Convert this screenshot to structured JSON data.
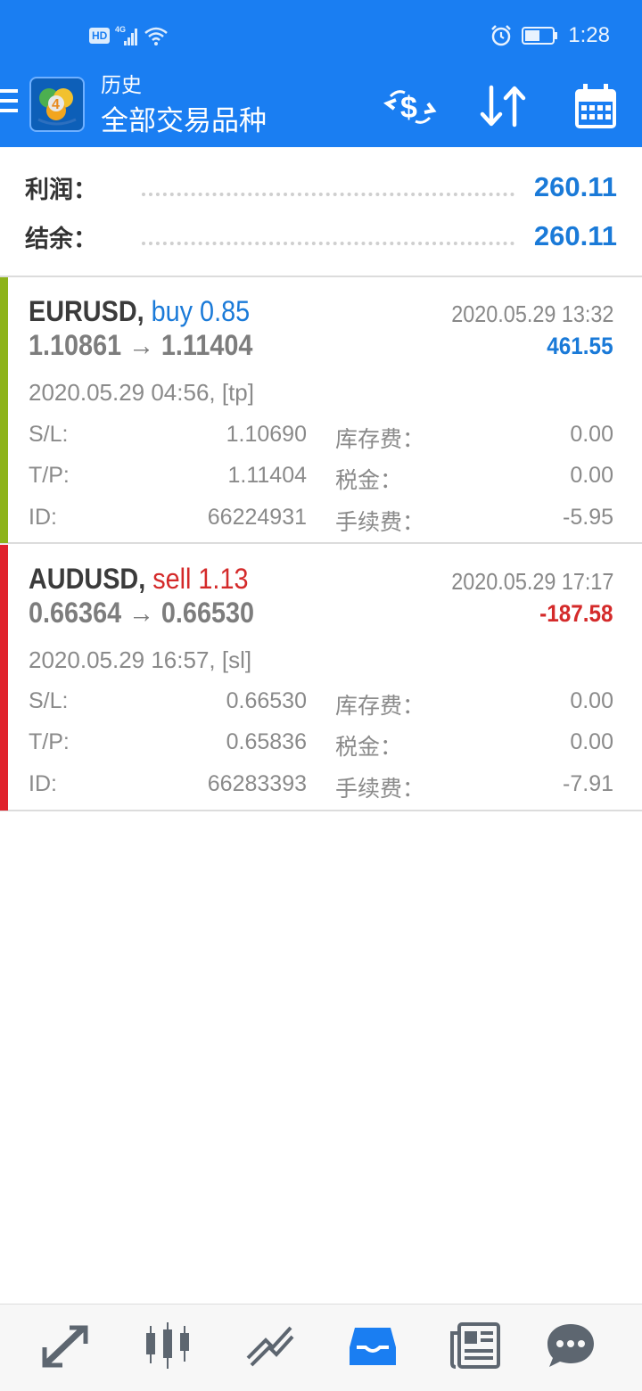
{
  "status_bar": {
    "network_badge": "HD",
    "signal_label": "4G",
    "time": "1:28",
    "icons": [
      "hd-icon",
      "signal-icon",
      "wifi-icon",
      "alarm-icon",
      "battery-icon"
    ]
  },
  "app_bar": {
    "title": "历史",
    "subtitle": "全部交易品种",
    "actions": [
      "currency-exchange-icon",
      "sort-icon",
      "calendar-icon"
    ],
    "colors": {
      "background": "#1a7ef2"
    }
  },
  "summary": {
    "profit_label": "利润：",
    "profit_value": "260.11",
    "balance_label": "结余：",
    "balance_value": "260.11",
    "value_color": "#1a7ad8"
  },
  "trades": [
    {
      "symbol": "EURUSD",
      "separator": ",",
      "side": "buy 0.85",
      "side_color": "#1a7ad8",
      "bar_color": "#8db31a",
      "close_time": "2020.05.29 13:32",
      "open_price": "1.10861",
      "arrow": "→",
      "close_price": "1.11404",
      "profit": "461.55",
      "profit_color": "#1a7ad8",
      "open_time": "2020.05.29 04:56, [tp]",
      "sl_label": "S/L:",
      "sl_value": "1.10690",
      "tp_label": "T/P:",
      "tp_value": "1.11404",
      "id_label": "ID:",
      "id_value": "66224931",
      "swap_label": "库存费：",
      "swap_value": "0.00",
      "tax_label": "税金：",
      "tax_value": "0.00",
      "commission_label": "手续费：",
      "commission_value": "-5.95"
    },
    {
      "symbol": "AUDUSD",
      "separator": ",",
      "side": "sell 1.13",
      "side_color": "#d42a2a",
      "bar_color": "#e0222b",
      "close_time": "2020.05.29 17:17",
      "open_price": "0.66364",
      "arrow": "→",
      "close_price": "0.66530",
      "profit": "-187.58",
      "profit_color": "#d42a2a",
      "open_time": "2020.05.29 16:57, [sl]",
      "sl_label": "S/L:",
      "sl_value": "0.66530",
      "tp_label": "T/P:",
      "tp_value": "0.65836",
      "id_label": "ID:",
      "id_value": "66283393",
      "swap_label": "库存费：",
      "swap_value": "0.00",
      "tax_label": "税金：",
      "tax_value": "0.00",
      "commission_label": "手续费：",
      "commission_value": "-7.91"
    }
  ],
  "bottom_nav": {
    "items": [
      "trade-icon",
      "quotes-chart-icon",
      "chart-icon",
      "history-icon",
      "news-icon",
      "chat-icon"
    ],
    "active_item": "history-icon",
    "active_color": "#1a7ef2",
    "inactive_color": "#5d6670"
  }
}
